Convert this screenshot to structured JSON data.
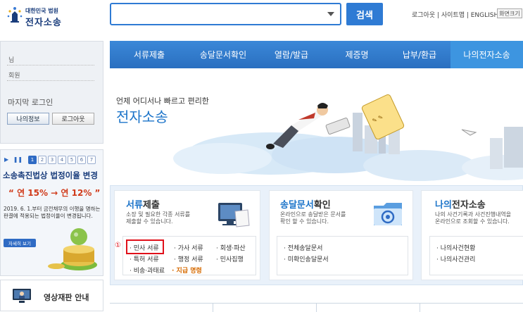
{
  "header": {
    "logo_small": "대한민국 법원",
    "logo_big": "전자소송",
    "search": {
      "value": "",
      "placeholder": ""
    },
    "search_button": "검색",
    "top_links": "로그아웃 | 사이트맵 | ENGLISH",
    "zoom_label": "화면크기"
  },
  "sidebar": {
    "login": {
      "row1": "님",
      "row2": "회원",
      "last_login": "마지막 로그인",
      "my_info_button": "나의정보",
      "logout_button": "로그아웃"
    },
    "promo": {
      "pages": [
        "1",
        "2",
        "3",
        "4",
        "5",
        "6",
        "7"
      ],
      "title": "소송촉진법상 법정이율 변경",
      "rate": "“ 연 15% → 연 12% ”",
      "text": "2019. 6. 1.부터 금전채무의 이행을 명하는 판결에 적용되는 법정이율이 변경됩니다.",
      "button": "자세히 보기"
    },
    "video_label": "영상재판 안내"
  },
  "nav": {
    "items": [
      "서류제출",
      "송달문서확인",
      "열람/발급",
      "제증명",
      "납부/환급",
      "나의전자소송"
    ]
  },
  "hero": {
    "subtitle": "언제 어디서나 빠르고 편리한",
    "title": "전자소송"
  },
  "services": {
    "submit": {
      "title_blue": "서류",
      "title_dark": "제출",
      "desc1": "소장 및 필요한 각종 서류를",
      "desc2": "제출할 수 있습니다.",
      "links": [
        "· 민사 서류",
        "· 가사 서류",
        "· 회생·파산",
        "· 특허 서류",
        "· 행정 서류",
        "· 민사집행",
        "· 비송·과태료",
        "· 지급 명령"
      ],
      "marker": "①"
    },
    "delivery": {
      "title_blue": "송달문서",
      "title_dark": "확인",
      "desc1": "온라인으로 송달받은 문서를",
      "desc2": "확인 할 수 있습니다.",
      "links": [
        "· 전체송달문서",
        "· 미확인송달문서"
      ]
    },
    "my": {
      "title_blue": "나의",
      "title_dark": "전자소송",
      "desc1": "나의 사건기록과 사건진행내역을",
      "desc2": "온라인으로 조회할 수 있습니다.",
      "links": [
        "· 나의사건현황",
        "· 나의사건관리"
      ]
    }
  },
  "colors": {
    "primary": "#2f7bd4",
    "highlight": "#e0101a",
    "orange": "#d66a00"
  }
}
